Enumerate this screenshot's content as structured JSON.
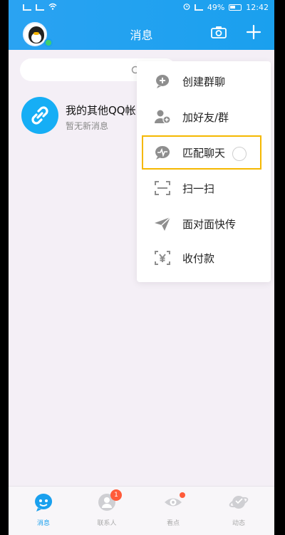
{
  "status_bar": {
    "battery": "49%",
    "time": "12:42"
  },
  "header": {
    "title": "消息"
  },
  "search": {
    "placeholder": ""
  },
  "chat_list": [
    {
      "name": "我的其他QQ帐",
      "subtitle": "暂无新消息"
    }
  ],
  "menu": {
    "items": [
      {
        "label": "创建群聊",
        "icon": "create-group-icon"
      },
      {
        "label": "加好友/群",
        "icon": "add-friend-icon"
      },
      {
        "label": "匹配聊天",
        "icon": "match-chat-icon",
        "highlighted": true
      },
      {
        "label": "扫一扫",
        "icon": "scan-icon"
      },
      {
        "label": "面对面快传",
        "icon": "send-icon"
      },
      {
        "label": "收付款",
        "icon": "payment-icon"
      }
    ]
  },
  "bottom_nav": {
    "items": [
      {
        "label": "消息",
        "active": true
      },
      {
        "label": "联系人",
        "badge": "1"
      },
      {
        "label": "看点",
        "dot": true
      },
      {
        "label": "动态"
      }
    ]
  },
  "colors": {
    "header_blue": "#1aa0ee",
    "highlight_yellow": "#f5b800",
    "badge_red": "#ff5b3a"
  }
}
